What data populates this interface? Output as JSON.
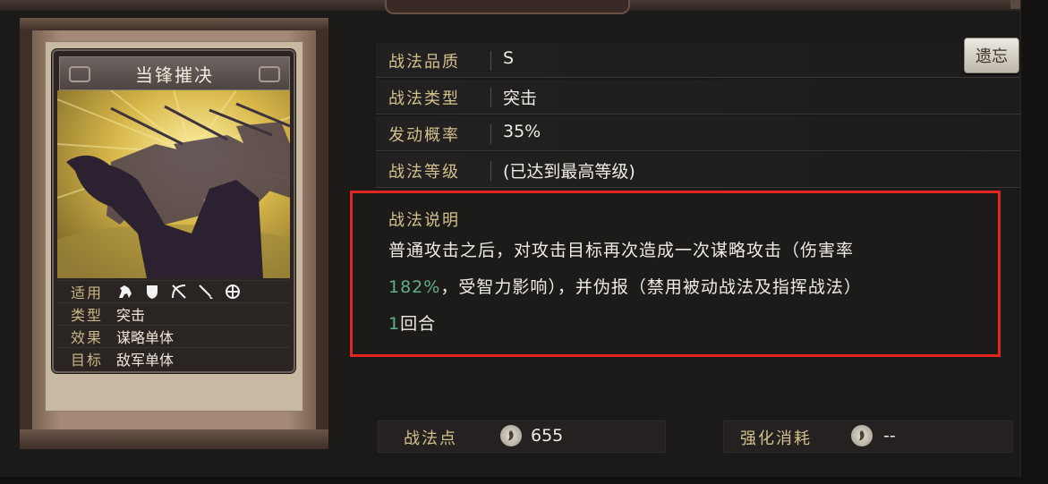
{
  "card": {
    "title": "当锋摧决",
    "props": [
      {
        "key": "适用",
        "value": ""
      },
      {
        "key": "类型",
        "value": "突击"
      },
      {
        "key": "效果",
        "value": "谋略单体"
      },
      {
        "key": "目标",
        "value": "敌军单体"
      }
    ],
    "troop_icons": [
      "cavalry-icon",
      "shield-icon",
      "bow-icon",
      "spear-icon",
      "chariot-icon"
    ]
  },
  "attributes": [
    {
      "key": "战法品质",
      "value": "S"
    },
    {
      "key": "战法类型",
      "value": "突击"
    },
    {
      "key": "发动概率",
      "value": "35%"
    },
    {
      "key": "战法等级",
      "value": "(已达到最高等级)"
    }
  ],
  "lost_button": "遗忘",
  "description": {
    "title": "战法说明",
    "line1": "普通攻击之后，对攻击目标再次造成一次谋略攻击（伤害率",
    "line2_highlight": "182%",
    "line2_rest": "，受智力影响），并伪报（禁用被动战法及指挥战法）",
    "line3_highlight": "1",
    "line3_rest": "回合"
  },
  "footer": {
    "points_label": "战法点",
    "points_value": "655",
    "cost_label": "强化消耗",
    "cost_value": "--"
  },
  "colors": {
    "label_gold": "#d2c18d",
    "highlight_green": "#5fb08a",
    "annotation_red": "#e0261f"
  }
}
